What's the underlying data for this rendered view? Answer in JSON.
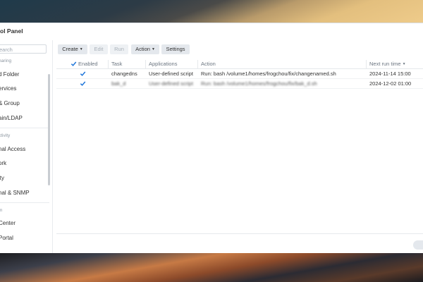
{
  "window": {
    "title": "ol Panel"
  },
  "sidebar": {
    "search_placeholder": "earch",
    "items": [
      {
        "kind": "head",
        "label": "haring"
      },
      {
        "kind": "item",
        "label": "d Folder"
      },
      {
        "kind": "item",
        "label": "ervices"
      },
      {
        "kind": "item",
        "label": "& Group"
      },
      {
        "kind": "item",
        "label": "ain/LDAP"
      },
      {
        "kind": "head",
        "label": "ctivity"
      },
      {
        "kind": "item",
        "label": "nal Access"
      },
      {
        "kind": "item",
        "label": "ork"
      },
      {
        "kind": "item",
        "label": "ity"
      },
      {
        "kind": "item",
        "label": "nal & SNMP"
      },
      {
        "kind": "head",
        "label": "m"
      },
      {
        "kind": "item",
        "label": "Center"
      },
      {
        "kind": "item",
        "label": "Portal"
      }
    ]
  },
  "toolbar": {
    "create": "Create",
    "edit": "Edit",
    "run": "Run",
    "action": "Action",
    "settings": "Settings"
  },
  "table": {
    "headers": {
      "enabled": "Enabled",
      "task": "Task",
      "applications": "Applications",
      "action": "Action",
      "next_run": "Next run time"
    },
    "rows": [
      {
        "enabled": true,
        "task": "changedns",
        "applications": "User-defined script",
        "action": "Run: bash /volume1/homes/frogchou/fix/changenamed.sh",
        "next_run": "2024-11-14 15:00",
        "blurred": false
      },
      {
        "enabled": true,
        "task": "bak_d",
        "applications": "User-defined script",
        "action": "Run: bash /volume1/homes/frogchou/fix/bak_d.sh",
        "next_run": "2024-12-02 01:00",
        "blurred": true
      }
    ]
  },
  "colors": {
    "accent": "#1a73d9",
    "button_bg": "#e4e8ed"
  }
}
